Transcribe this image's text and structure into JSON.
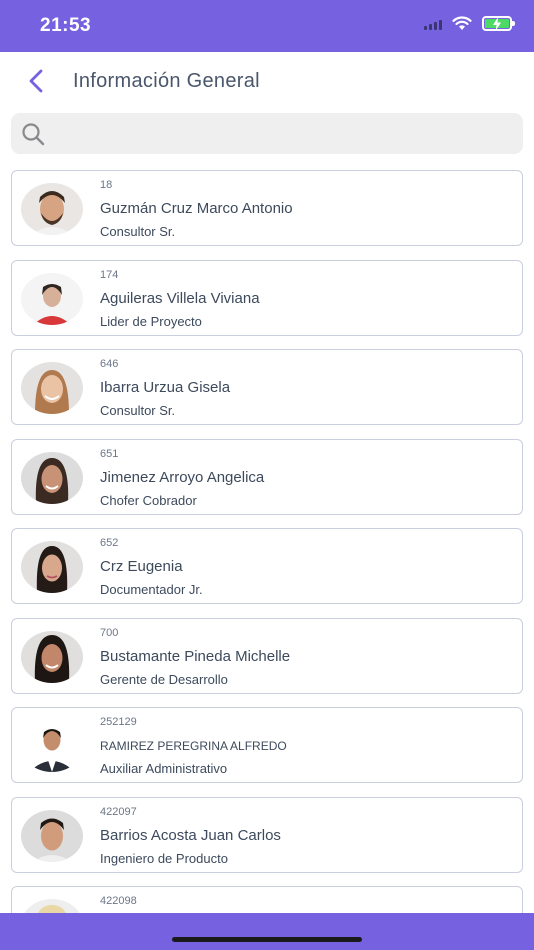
{
  "status_bar": {
    "time": "21:53",
    "background_color": "#7662e0",
    "icons": [
      "cellular-signal-icon",
      "wifi-icon",
      "battery-charging-icon"
    ]
  },
  "header": {
    "title": "Información General",
    "back_icon": "chevron-left-icon",
    "accent_color": "#7662e0"
  },
  "search": {
    "placeholder": "",
    "value": "",
    "icon": "search-icon"
  },
  "employees": [
    {
      "id": "18",
      "name": "Guzmán Cruz Marco Antonio",
      "role": "Consultor Sr."
    },
    {
      "id": "174",
      "name": "Aguileras Villela Viviana",
      "role": "Lider de Proyecto"
    },
    {
      "id": "646",
      "name": "Ibarra Urzua Gisela",
      "role": "Consultor Sr."
    },
    {
      "id": "651",
      "name": "Jimenez Arroyo Angelica",
      "role": "Chofer Cobrador"
    },
    {
      "id": "652",
      "name": "Crz  Eugenia",
      "role": "Documentador Jr."
    },
    {
      "id": "700",
      "name": "Bustamante Pineda Michelle",
      "role": "Gerente de Desarrollo"
    },
    {
      "id": "252129",
      "name": "RAMIREZ PEREGRINA ALFREDO",
      "role": "Auxiliar Administrativo"
    },
    {
      "id": "422097",
      "name": "Barrios Acosta Juan Carlos",
      "role": "Ingeniero de Producto"
    },
    {
      "id": "422098",
      "name": "",
      "role": ""
    }
  ]
}
